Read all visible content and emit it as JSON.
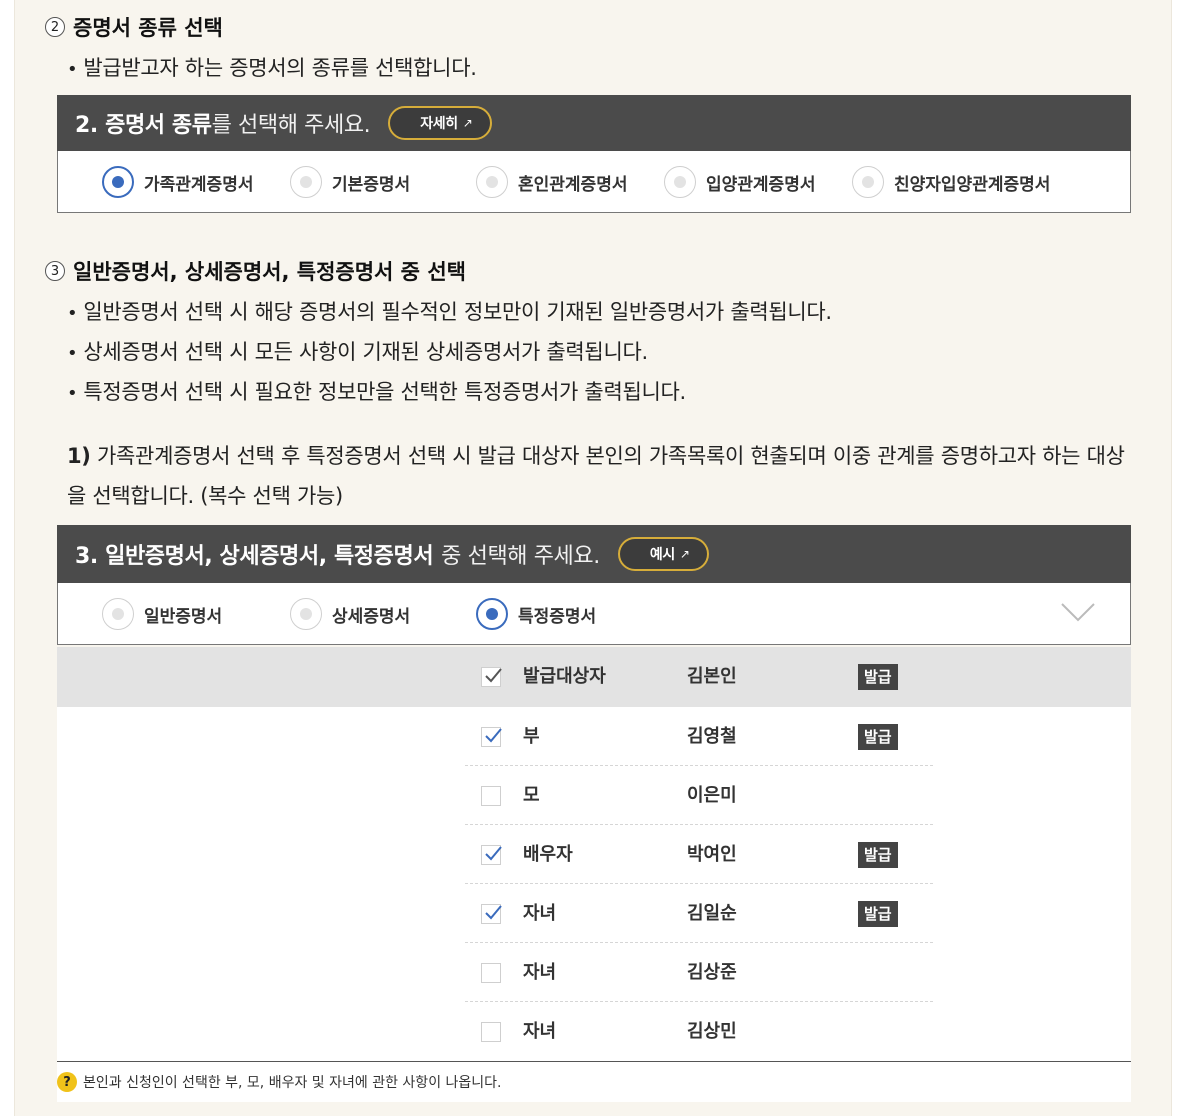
{
  "section2": {
    "num": "2",
    "title": "증명서 종류 선택",
    "bullet": "발급받고자 하는 증명서의 종류를 선택합니다.",
    "panel": {
      "head_strong_1": "2. 증명서 종류",
      "head_light": "를 선택해 주세요.",
      "detail_button": "자세히",
      "options": [
        "가족관계증명서",
        "기본증명서",
        "혼인관계증명서",
        "입양관계증명서",
        "친양자입양관계증명서"
      ],
      "selected": "가족관계증명서"
    }
  },
  "section3": {
    "num": "3",
    "title": "일반증명서, 상세증명서, 특정증명서 중 선택",
    "bullets": [
      "일반증명서 선택 시 해당 증명서의 필수적인 정보만이 기재된 일반증명서가 출력됩니다.",
      "상세증명서 선택 시 모든 사항이 기재된 상세증명서가 출력됩니다.",
      "특정증명서 선택 시 필요한 정보만을 선택한 특정증명서가 출력됩니다."
    ],
    "para_num": "1)",
    "para_text": "가족관계증명서 선택 후 특정증명서 선택 시 발급 대상자 본인의 가족목록이 현출되며 이중 관계를 증명하고자 하는 대상을 선택합니다. (복수 선택 가능)",
    "panel": {
      "head_strong": "3. 일반증명서, 상세증명서, 특정증명서",
      "head_light": "중 선택해 주세요.",
      "example_button": "예시",
      "options": [
        "일반증명서",
        "상세증명서",
        "특정증명서"
      ],
      "selected": "특정증명서"
    },
    "family": [
      {
        "relation": "발급대상자",
        "name": "김본인",
        "checked": true,
        "badge": "발급"
      },
      {
        "relation": "부",
        "name": "김영철",
        "checked": true,
        "badge": "발급"
      },
      {
        "relation": "모",
        "name": "이은미",
        "checked": false,
        "badge": ""
      },
      {
        "relation": "배우자",
        "name": "박여인",
        "checked": true,
        "badge": "발급"
      },
      {
        "relation": "자녀",
        "name": "김일순",
        "checked": true,
        "badge": "발급"
      },
      {
        "relation": "자녀",
        "name": "김상준",
        "checked": false,
        "badge": ""
      },
      {
        "relation": "자녀",
        "name": "김상민",
        "checked": false,
        "badge": ""
      }
    ],
    "note": "본인과 신청인이 선택한 부, 모, 배우자 및 자녀에 관한 사항이 나옵니다."
  },
  "colors": {
    "accent_blue": "#3a6bbd",
    "panel_head": "#4b4b4b",
    "pill_border": "#d6ad3a",
    "badge": "#444444"
  },
  "icons": {
    "external": "external-link-icon",
    "question": "question-icon",
    "chevron": "chevron-down-icon"
  }
}
